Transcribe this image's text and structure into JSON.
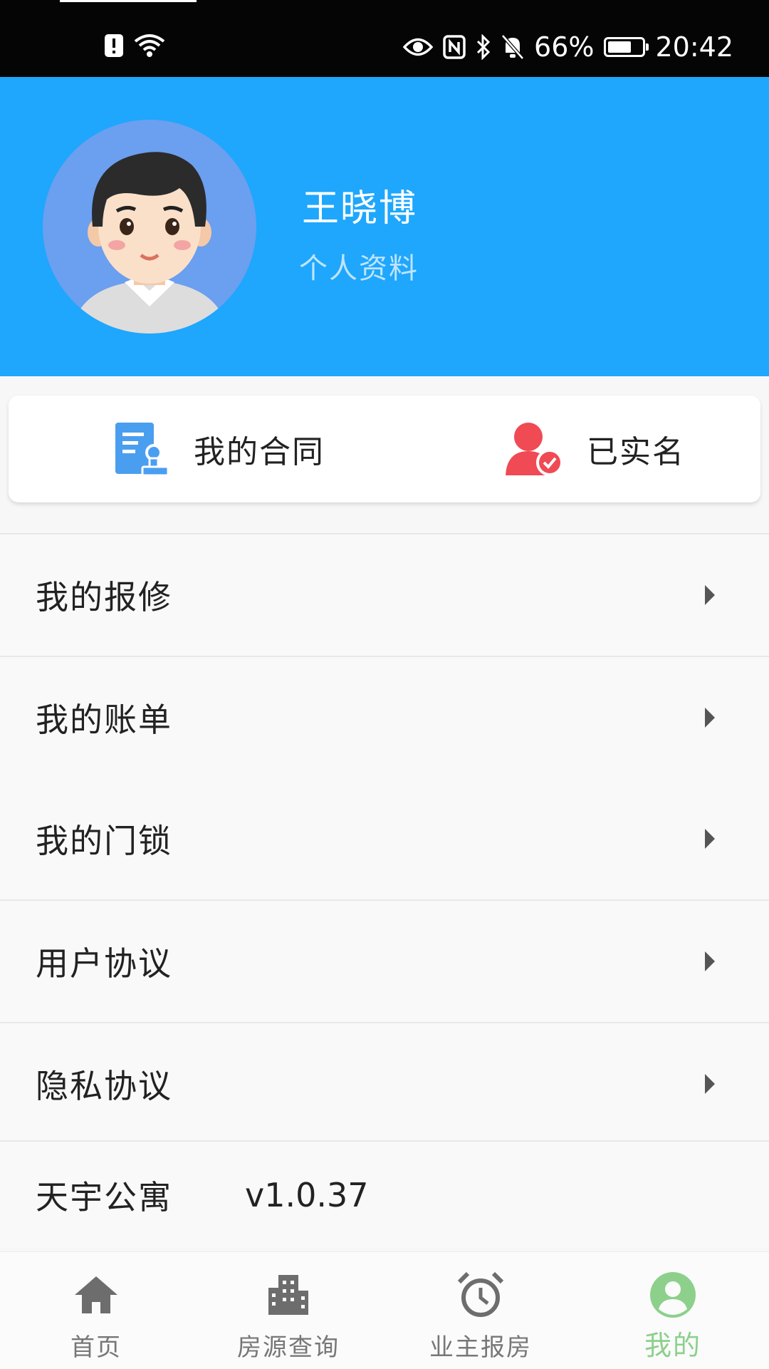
{
  "status_bar": {
    "battery_percent": "66%",
    "time": "20:42",
    "battery_level": 0.66
  },
  "profile": {
    "name": "王晓博",
    "link_label": "个人资料"
  },
  "quick_actions": {
    "contract_label": "我的合同",
    "verified_label": "已实名"
  },
  "menu": {
    "items": [
      {
        "label": "我的报修"
      },
      {
        "label": "我的账单"
      },
      {
        "label": "我的门锁"
      },
      {
        "label": "用户协议"
      },
      {
        "label": "隐私协议"
      }
    ]
  },
  "app_info": {
    "name": "天宇公寓",
    "version": "v1.0.37"
  },
  "tabbar": {
    "tabs": [
      {
        "label": "首页",
        "icon": "home-icon"
      },
      {
        "label": "房源查询",
        "icon": "building-icon"
      },
      {
        "label": "业主报房",
        "icon": "alarm-clock-icon"
      },
      {
        "label": "我的",
        "icon": "user-icon"
      }
    ],
    "active_index": 3,
    "active_color": "#8cd08c",
    "inactive_color": "#777777"
  },
  "colors": {
    "header_bg": "#1ea7fc",
    "contract_icon": "#4a9ef0",
    "verified_icon": "#f04a55"
  }
}
